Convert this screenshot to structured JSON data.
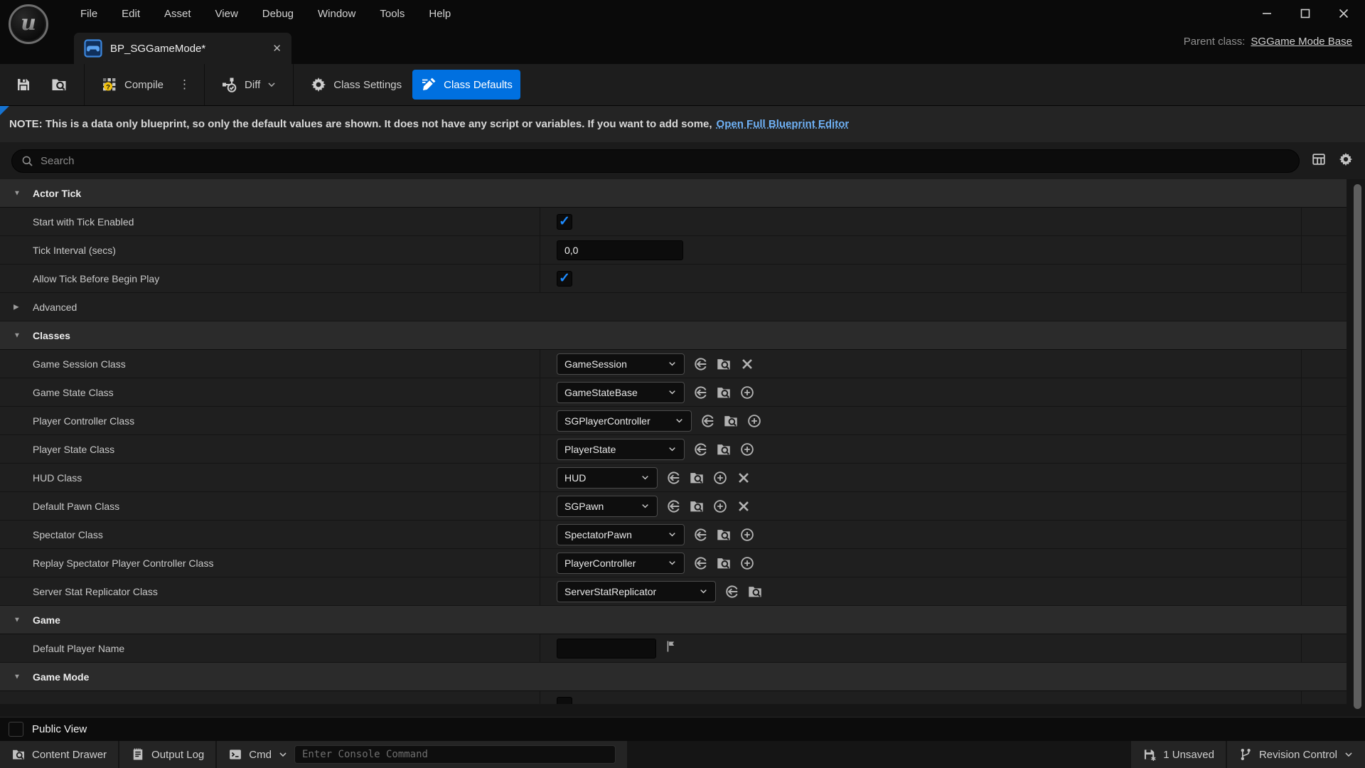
{
  "titlebar": {
    "menu_items": [
      "File",
      "Edit",
      "Asset",
      "View",
      "Debug",
      "Window",
      "Tools",
      "Help"
    ],
    "window_controls": [
      "minimize",
      "maximize",
      "close"
    ]
  },
  "tabbar": {
    "tab_title": "BP_SGGameMode*",
    "close_glyph": "✕",
    "parent_class_label": "Parent class:",
    "parent_class_value": "SGGame Mode Base"
  },
  "toolbar": {
    "compile_label": "Compile",
    "diff_label": "Diff",
    "class_settings_label": "Class Settings",
    "class_defaults_label": "Class Defaults"
  },
  "note": {
    "prefix": "NOTE: This is a data only blueprint, so only the default values are shown.  It does not have any script or variables.  If you want to add some,",
    "link": "Open Full Blueprint Editor"
  },
  "search": {
    "placeholder": "Search"
  },
  "details": {
    "rows": [
      {
        "type": "category",
        "label": "Actor Tick",
        "expanded": true
      },
      {
        "type": "property",
        "label": "Start with Tick Enabled",
        "control": "checkbox",
        "checked": true
      },
      {
        "type": "property",
        "label": "Tick Interval (secs)",
        "control": "text",
        "value": "0,0"
      },
      {
        "type": "property",
        "label": "Allow Tick Before Begin Play",
        "control": "checkbox",
        "checked": true
      },
      {
        "type": "expander",
        "label": "Advanced",
        "expanded": false
      },
      {
        "type": "category",
        "label": "Classes",
        "expanded": true
      },
      {
        "type": "class",
        "label": "Game Session Class",
        "value": "GameSession",
        "actions": [
          "use-selected",
          "browse-to",
          "clear"
        ]
      },
      {
        "type": "class",
        "label": "Game State Class",
        "value": "GameStateBase",
        "actions": [
          "use-selected",
          "browse-to",
          "add"
        ]
      },
      {
        "type": "class",
        "label": "Player Controller Class",
        "value": "SGPlayerController",
        "actions": [
          "use-selected",
          "browse-to",
          "add"
        ]
      },
      {
        "type": "class",
        "label": "Player State Class",
        "value": "PlayerState",
        "actions": [
          "use-selected",
          "browse-to",
          "add"
        ]
      },
      {
        "type": "class",
        "label": "HUD Class",
        "value": "HUD",
        "actions": [
          "use-selected",
          "browse-to",
          "add",
          "clear"
        ]
      },
      {
        "type": "class",
        "label": "Default Pawn Class",
        "value": "SGPawn",
        "actions": [
          "use-selected",
          "browse-to",
          "add",
          "clear"
        ]
      },
      {
        "type": "class",
        "label": "Spectator Class",
        "value": "SpectatorPawn",
        "actions": [
          "use-selected",
          "browse-to",
          "add"
        ]
      },
      {
        "type": "class",
        "label": "Replay Spectator Player Controller Class",
        "value": "PlayerController",
        "actions": [
          "use-selected",
          "browse-to",
          "add"
        ]
      },
      {
        "type": "class",
        "label": "Server Stat Replicator Class",
        "value": "ServerStatReplicator",
        "actions": [
          "use-selected",
          "browse-to"
        ]
      },
      {
        "type": "category",
        "label": "Game",
        "expanded": true
      },
      {
        "type": "property",
        "label": "Default Player Name",
        "control": "text-with-flag",
        "value": ""
      },
      {
        "type": "category",
        "label": "Game Mode",
        "expanded": true
      }
    ]
  },
  "footer": {
    "public_view_label": "Public View",
    "public_view_checked": false,
    "content_drawer_label": "Content Drawer",
    "output_log_label": "Output Log",
    "cmd_label": "Cmd",
    "console_placeholder": "Enter Console Command",
    "unsaved_label": "1 Unsaved",
    "revision_control_label": "Revision Control"
  },
  "icons": {
    "search-icon": "🔍 magnifier",
    "settings-gear-icon": "⚙",
    "expand-arrow-down": "▼",
    "expand-arrow-right": "▶",
    "dropdown-chevron": "⌄",
    "use-selected-icon": "circled left arrow",
    "browse-to-icon": "folder with magnifier",
    "add-icon": "⊕",
    "clear-icon": "✕",
    "flag-icon": "⚑"
  },
  "colors": {
    "accent_blue": "#0070e0",
    "check_blue": "#1d8bff",
    "link_blue": "#6fb1f5",
    "panel_bg": "#1f1f1f",
    "category_bg": "#2b2b2b",
    "titlebar_bg": "#0a0a0a"
  }
}
